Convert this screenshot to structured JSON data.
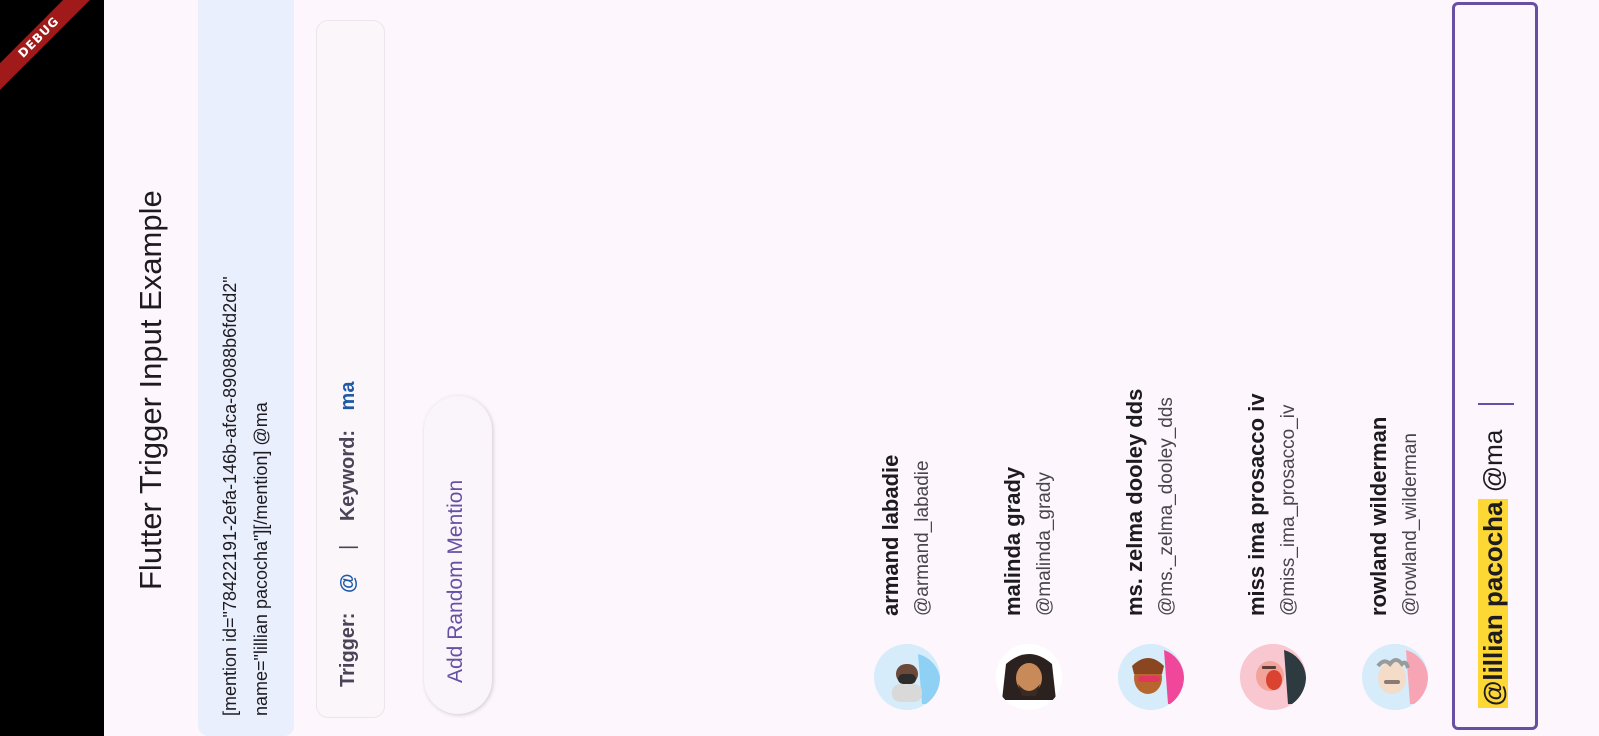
{
  "debug_banner": "DEBUG",
  "app": {
    "title": "Flutter Trigger Input Example"
  },
  "serialized": {
    "line1": "[mention id=\"78422191-2efa-146b-afca-89088b6fd2d2\"",
    "line2": "name=\"lillian pacocha\"][/mention] @ma"
  },
  "trigger_info": {
    "trigger_label": "Trigger:",
    "trigger_value": "@",
    "separator": "|",
    "keyword_label": "Keyword:",
    "keyword_value": "ma"
  },
  "add_button": {
    "label": "Add Random Mention"
  },
  "suggestions": [
    {
      "name": "armand labadie",
      "handle": "@armand_labadie",
      "avatar": "avatar-armand"
    },
    {
      "name": "malinda grady",
      "handle": "@malinda_grady",
      "avatar": "avatar-malinda"
    },
    {
      "name": "ms. zelma dooley dds",
      "handle": "@ms._zelma_dooley_dds",
      "avatar": "avatar-zelma"
    },
    {
      "name": "miss ima prosacco iv",
      "handle": "@miss_ima_prosacco_iv",
      "avatar": "avatar-ima"
    },
    {
      "name": "rowland wilderman",
      "handle": "@rowland_wilderman",
      "avatar": "avatar-rowland"
    }
  ],
  "input": {
    "mention_chip": "@lillian pacocha",
    "typed_text": "@ma"
  },
  "colors": {
    "accent": "#6750a4",
    "chip_highlight": "#fdd835",
    "keyword_blue": "#1e5aa8",
    "debug_red": "#a11a1a"
  }
}
